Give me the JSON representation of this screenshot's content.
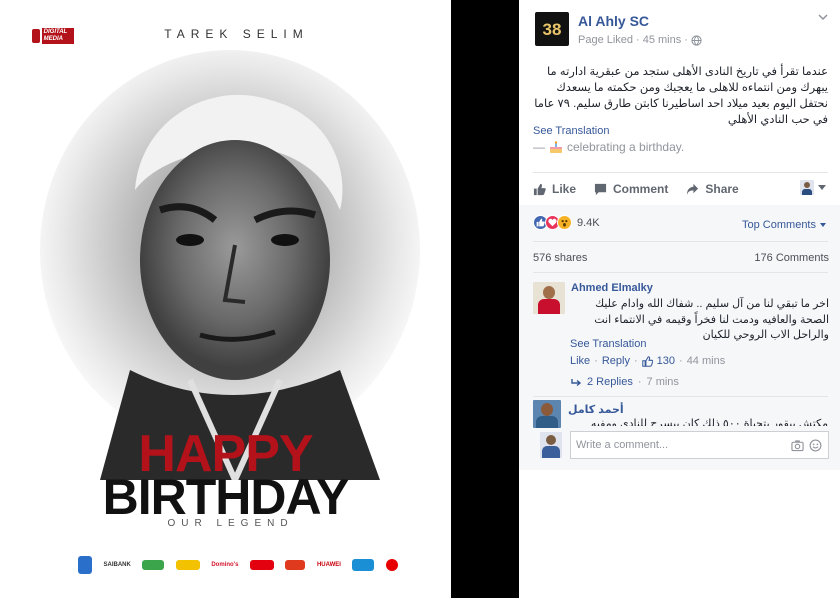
{
  "poster": {
    "brand_label": "DIGITAL MEDIA",
    "header_name": "TAREK SELIM",
    "headline_line1": "HAPPY",
    "headline_line2": "BIRTHDAY",
    "tagline": "OUR LEGEND",
    "sponsors": [
      "SAIBANK",
      "Domino's",
      "HUAWEI"
    ],
    "colors": {
      "headline_red": "#b3121a",
      "headline_black": "#111111"
    }
  },
  "post": {
    "page_logo_text": "38",
    "page_name": "Al Ahly SC",
    "meta_status": "Page Liked",
    "meta_time": "45 mins",
    "body": "عندما تقرأ في تاريخ النادى الأهلى ستجد من عبقرية ادارته ما يبهرك ومن انتماءه للاهلى ما يعجبك ومن حكمته ما يسعدك نحتفل اليوم بعيد ميلاد احد اساطيرنا كابتن طارق سليم. ٧٩ عاما في حب النادي الأهلي",
    "see_translation": "See Translation",
    "activity_prefix": "—",
    "activity": "celebrating a birthday."
  },
  "actions": {
    "like": "Like",
    "comment": "Comment",
    "share": "Share"
  },
  "stats": {
    "reactions": "9.4K",
    "top_comments": "Top Comments",
    "shares": "576 shares",
    "comments": "176 Comments"
  },
  "comments": [
    {
      "author": "Ahmed Elmalky",
      "text": "اخر ما تبقي لنا من آل سليم .. شفاك الله وادام عليك الصحة والعافيه ودمت لنا فخراً وقيمه في الانتماء انت والراحل الاب الروحي للكيان",
      "see_translation": "See Translation",
      "like": "Like",
      "reply": "Reply",
      "likes": "130",
      "time": "44 mins",
      "replies": "2 Replies",
      "replies_time": "7 mins"
    },
    {
      "author": "أحمد كامل",
      "text": "مكتش بيقور بتحياة ٥٠٠ ذلك كان بيسرح للنادي ومفيه"
    }
  ],
  "composer": {
    "placeholder": "Write a comment..."
  },
  "colors": {
    "link_blue": "#365899",
    "like_blue": "#4267b2",
    "love_red": "#e9345b",
    "wow_yellow": "#f7b125"
  }
}
